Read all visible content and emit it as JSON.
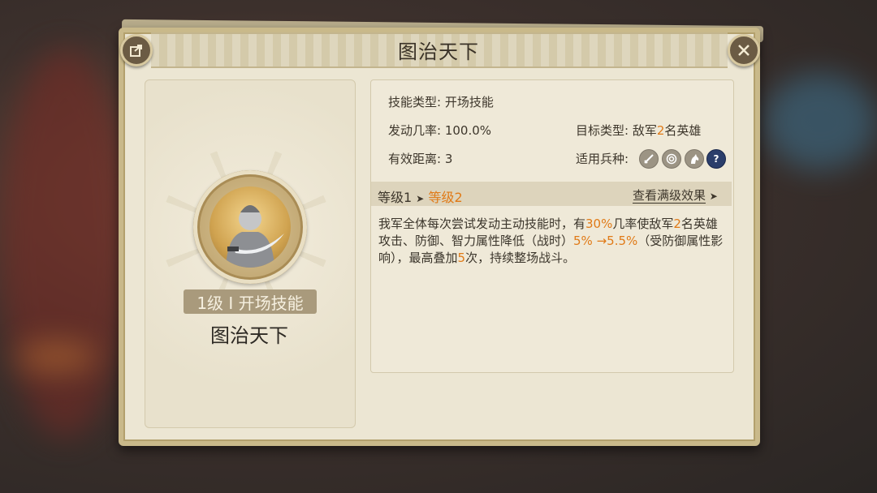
{
  "dialog": {
    "title": "图治天下"
  },
  "skill_card": {
    "level_tag": "1级 I 开场技能",
    "name": "图治天下"
  },
  "info": {
    "skill_type_label": "技能类型:",
    "skill_type_value": "开场技能",
    "trigger_rate_label": "发动几率:",
    "trigger_rate_value": "100.0%",
    "target_type_label": "目标类型:",
    "target_prefix": "敌军",
    "target_count": "2",
    "target_suffix": "名英雄",
    "range_label": "有效距离:",
    "range_value": "3",
    "troop_label": "适用兵种:",
    "troop_icons": [
      "sword-icon",
      "target-icon",
      "horse-icon",
      "question-icon"
    ]
  },
  "level_bar": {
    "level_from": "等级1",
    "arrow": "➤",
    "level_to": "等级2",
    "view_max_label": "查看满级效果",
    "view_max_arrow": "➤"
  },
  "description": {
    "p1": "我军全体每次尝试发动主动技能时，有",
    "v1": "30%",
    "p2": "几率使敌军",
    "v2": "2",
    "p3": "名英雄攻击、防御、智力属性降低（战时）",
    "v3": "5% →5.5%",
    "p4": "（受防御属性影响），最高叠加",
    "v4": "5",
    "p5": "次，持续整场战斗。"
  },
  "colors": {
    "highlight": "#e07a17",
    "panel_bg": "#ece6d3",
    "border": "#c9b98a"
  }
}
